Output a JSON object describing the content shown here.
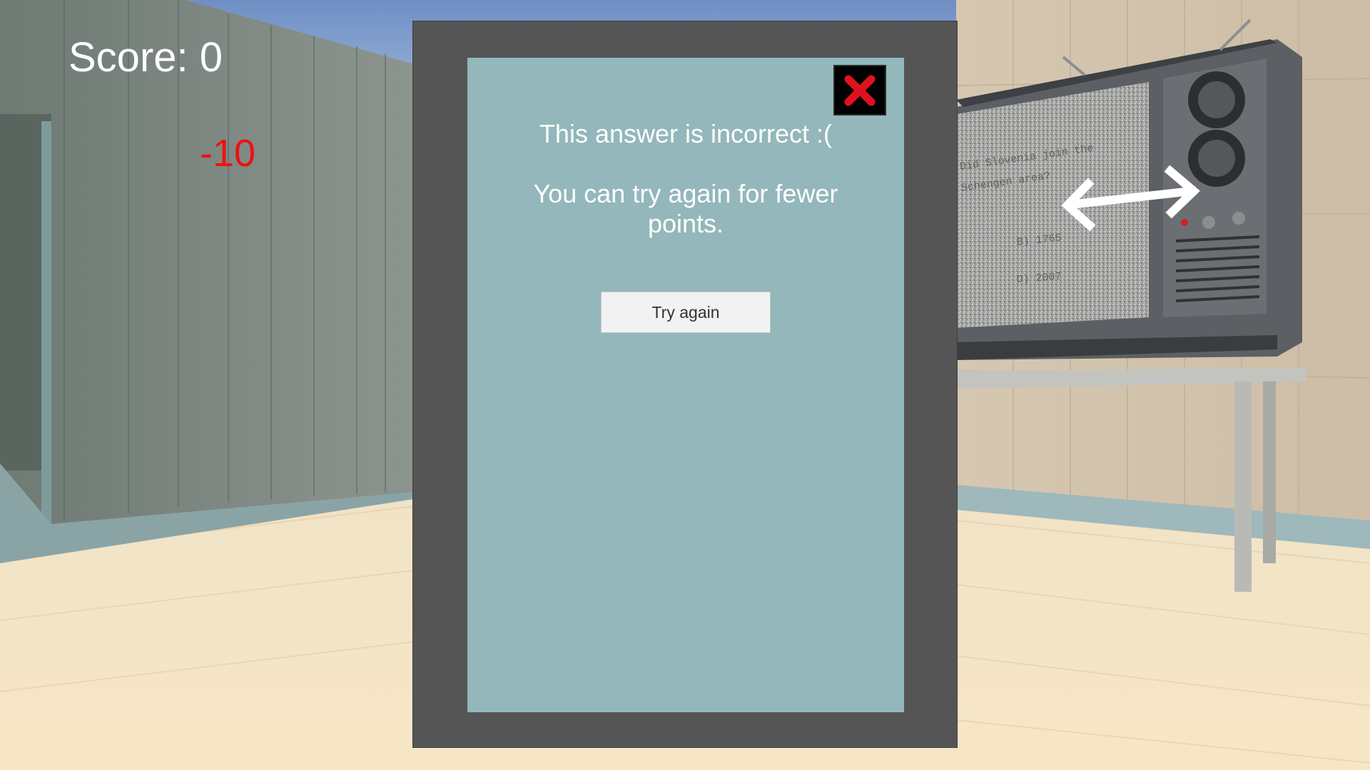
{
  "hud": {
    "score_text": "Score: 0",
    "score_delta": "-10"
  },
  "dialog": {
    "message_incorrect": "This answer is incorrect :(",
    "message_retry": "You can try again for fewer points.",
    "try_again_label": "Try again",
    "close_icon": "close-x-icon"
  },
  "tv_screen": {
    "question_fragment_1": "Did Slovenia join the",
    "question_fragment_2": "Schengen area?",
    "answer_b": "B) 1765",
    "answer_d": "D) 2007"
  },
  "colors": {
    "dialog_frame": "#555555",
    "dialog_panel": "#93b7ba",
    "score_text": "#ffffff",
    "score_delta": "#ee1111",
    "close_x": "#e0111f"
  }
}
